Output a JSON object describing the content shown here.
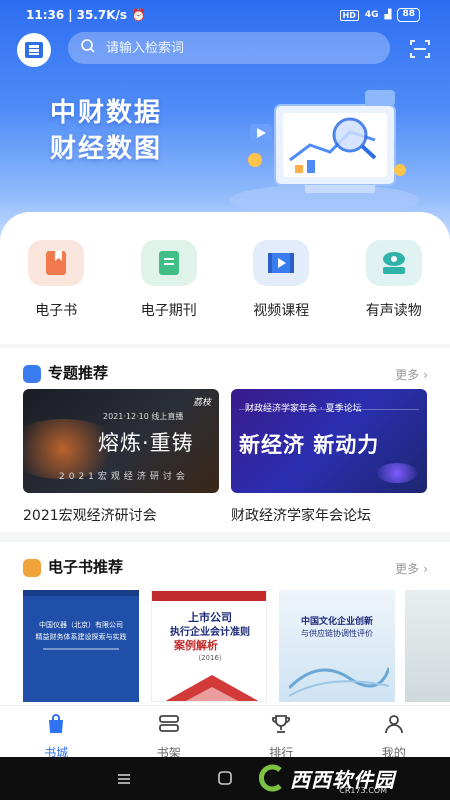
{
  "status_bar": {
    "time": "11:36",
    "speed": "35.7K/s",
    "network": "4G",
    "battery": "88"
  },
  "search": {
    "placeholder": "请输入检索词"
  },
  "banner": {
    "line1": "中财数据",
    "line2": "财经数图"
  },
  "categories": [
    {
      "label": "电子书",
      "icon": "book-icon",
      "color": "#fbe6dd"
    },
    {
      "label": "电子期刊",
      "icon": "journal-icon",
      "color": "#dff3ea"
    },
    {
      "label": "视频课程",
      "icon": "video-icon",
      "color": "#e2ecfb"
    },
    {
      "label": "有声读物",
      "icon": "audio-icon",
      "color": "#e0f3f2"
    }
  ],
  "topics": {
    "title": "专题推荐",
    "more": "更多",
    "cards": [
      {
        "title": "2021宏观经济研讨会",
        "img_date": "2021·12·10  线上直播",
        "img_main": "熔炼·重铸",
        "img_sub": "2021宏观经济研讨会",
        "img_tag": "荔枝"
      },
      {
        "title": "财政经济学家年会论坛",
        "img_header": "财政经济学家年会 · 夏季论坛",
        "img_main": "新经济  新动力"
      }
    ]
  },
  "ebooks": {
    "title": "电子书推荐",
    "more": "更多",
    "books": [
      {
        "title_line1": "中国仪器（北京）有限公司",
        "title_line2": "精益财务体系建设探索与实践"
      },
      {
        "title_line1": "上市公司",
        "title_line2": "执行企业会计准则",
        "title_line3": "案例解析",
        "year": "（2016）"
      },
      {
        "title_line1": "中国文化企业创新",
        "title_line2": "与供应链协调性评价"
      }
    ]
  },
  "tabs": [
    {
      "label": "书城",
      "icon": "bag-icon",
      "active": true
    },
    {
      "label": "书架",
      "icon": "shelf-icon",
      "active": false
    },
    {
      "label": "排行",
      "icon": "trophy-icon",
      "active": false
    },
    {
      "label": "我的",
      "icon": "user-icon",
      "active": false
    }
  ],
  "watermark": {
    "text": "西西软件园",
    "sub": "CR173.COM"
  },
  "colors": {
    "primary": "#3073f0",
    "hero_top": "#2d6df2",
    "accent_orange": "#f2a23a"
  }
}
